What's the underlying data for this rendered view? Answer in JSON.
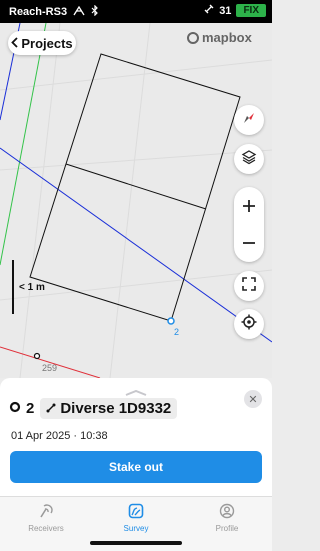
{
  "status_bar": {
    "device_name": "Reach-RS3",
    "satellites": "31",
    "fix_label": "FIX",
    "fix_color": "#2db24a"
  },
  "map": {
    "projects_button": "Projects",
    "mapbox_label": "mapbox",
    "scale_label": "< 1 m",
    "point_labels": {
      "survey_point": "2",
      "other_point": "259"
    },
    "buttons": [
      "compass-icon",
      "layers-icon",
      "zoom-in-icon",
      "zoom-out-icon",
      "fullscreen-icon",
      "locate-icon"
    ]
  },
  "sheet": {
    "point_number": "2",
    "point_name": "Diverse 1D9332",
    "datetime": "01 Apr 2025 · 10:38",
    "stake_out_label": "Stake out",
    "accent_color": "#1f8de6"
  },
  "tabs": [
    {
      "label": "Receivers",
      "icon": "receivers-icon",
      "active": false
    },
    {
      "label": "Survey",
      "icon": "survey-icon",
      "active": true
    },
    {
      "label": "Profile",
      "icon": "profile-icon",
      "active": false
    }
  ]
}
